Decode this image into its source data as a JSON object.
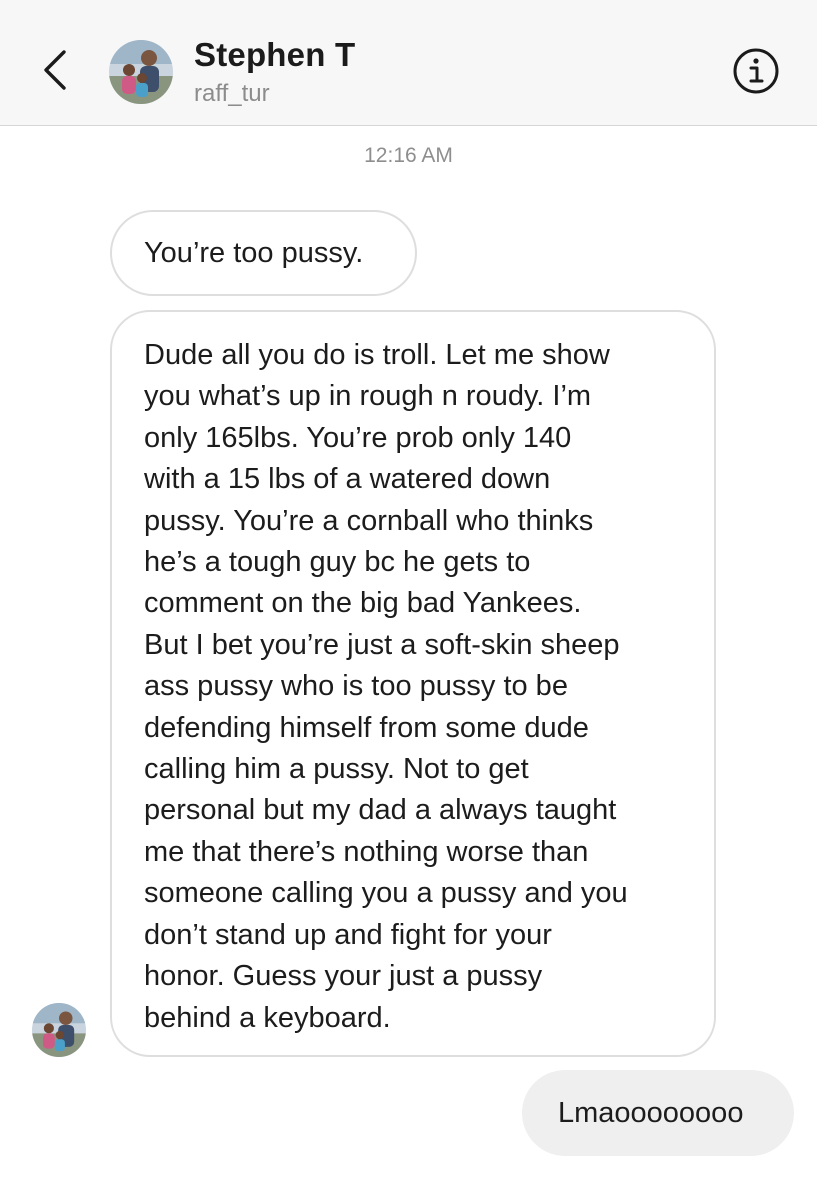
{
  "header": {
    "contact_name": "Stephen T",
    "contact_handle": "raff_tur",
    "back_icon": "chevron-left-icon",
    "info_icon": "info-icon"
  },
  "thread": {
    "timestamp": "12:16 AM",
    "messages": [
      {
        "direction": "incoming",
        "lines": [
          "You’re too pussy."
        ]
      },
      {
        "direction": "incoming",
        "lines": [
          "Dude all you do is troll. Let me show",
          "you what’s up in rough n roudy. I’m",
          "only 165lbs. You’re prob only 140",
          "with a 15 lbs of a watered down",
          "pussy. You’re a cornball who thinks",
          "he’s a tough guy bc he gets to",
          "comment on the big bad Yankees.",
          "But I bet you’re just a soft-skin sheep",
          "ass pussy who is too pussy to be",
          "defending himself from some dude",
          "calling him a pussy. Not to get",
          "personal but my dad a always taught",
          "me that there’s nothing worse than",
          "someone calling you a pussy and you",
          "don’t stand up and fight for your",
          "honor. Guess your just a pussy",
          "behind a keyboard."
        ]
      },
      {
        "direction": "outgoing",
        "lines": [
          "Lmaoooooooo"
        ]
      }
    ]
  },
  "colors": {
    "header_bg": "#f7f7f7",
    "incoming_border": "#dedede",
    "outgoing_bg": "#efefef",
    "timestamp": "#8e8e8e",
    "handle": "#8c8c8c"
  }
}
